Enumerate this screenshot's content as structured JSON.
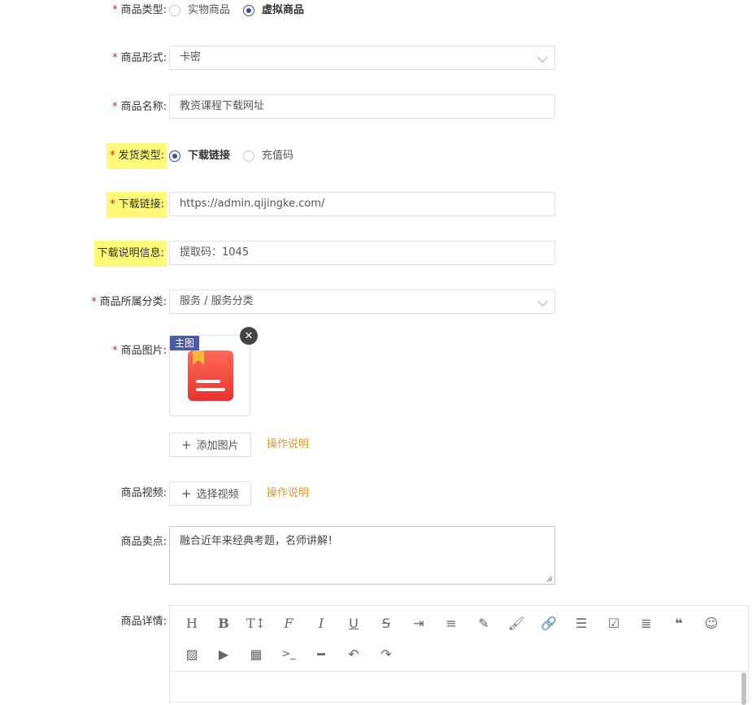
{
  "form": {
    "product_type": {
      "label": "商品类型:",
      "options": [
        "实物商品",
        "虚拟商品"
      ],
      "selected": "虚拟商品"
    },
    "product_form": {
      "label": "商品形式:",
      "value": "卡密"
    },
    "product_name": {
      "label": "商品名称:",
      "value": "教资课程下载网址"
    },
    "delivery_type": {
      "label": "发货类型:",
      "options": [
        "下载链接",
        "充值码"
      ],
      "selected": "下载链接"
    },
    "download_link": {
      "label": "下载链接:",
      "value": "https://admin.qijingke.com/"
    },
    "download_info": {
      "label": "下载说明信息:",
      "value": "提取码：1045"
    },
    "category": {
      "label": "商品所属分类:",
      "value": "服务 / 服务分类"
    },
    "images": {
      "label": "商品图片:",
      "main_tag": "主图",
      "add_label": "添加图片",
      "help": "操作说明"
    },
    "video": {
      "label": "商品视频:",
      "select_label": "选择视频",
      "help": "操作说明"
    },
    "selling_point": {
      "label": "商品卖点:",
      "value": "融合近年来经典考题，名师讲解！"
    },
    "detail": {
      "label": "商品详情:"
    }
  },
  "colors": {
    "required": "#e02020",
    "highlight": "#fdfa7a",
    "accent": "#3a4ca3",
    "link": "#e5961f"
  },
  "toolbar_icons": [
    "heading-icon",
    "bold-icon",
    "text-size-icon",
    "font-icon",
    "italic-icon",
    "underline-icon",
    "strikethrough-icon",
    "indent-icon",
    "line-height-icon",
    "pen-icon",
    "brush-icon",
    "link-icon",
    "list-icon",
    "checkbox-icon",
    "align-icon",
    "quote-icon",
    "emoji-icon",
    "image-icon",
    "video-icon",
    "table-icon",
    "code-icon",
    "hr-icon",
    "undo-icon",
    "redo-icon"
  ]
}
